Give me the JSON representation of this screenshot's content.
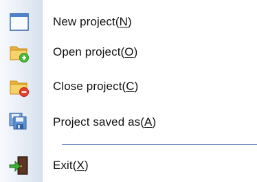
{
  "menu": {
    "items": [
      {
        "id": "new",
        "label_text": "New project(",
        "mnemonic": "N",
        "label_end": ")",
        "icon": "new-project-icon"
      },
      {
        "id": "open",
        "label_text": "Open project(",
        "mnemonic": "O",
        "label_end": ")",
        "icon": "open-folder-add-icon"
      },
      {
        "id": "close",
        "label_text": "Close project(",
        "mnemonic": "C",
        "label_end": ")",
        "icon": "close-folder-remove-icon"
      },
      {
        "id": "saveas",
        "label_text": "Project saved as(",
        "mnemonic": "A",
        "label_end": ")",
        "icon": "save-as-icon"
      },
      {
        "id": "exit",
        "label_text": "Exit(",
        "mnemonic": "X",
        "label_end": ")",
        "icon": "exit-door-icon"
      }
    ]
  },
  "colors": {
    "gutter_light": "#f7f9fd",
    "gutter_dark": "#d7e0ec",
    "separator": "#6d8fbf",
    "text": "#111111",
    "folder_yellow": "#f3c244",
    "add_green": "#4dbb3a",
    "remove_red": "#e4412e",
    "save_blue": "#3c70b8"
  }
}
